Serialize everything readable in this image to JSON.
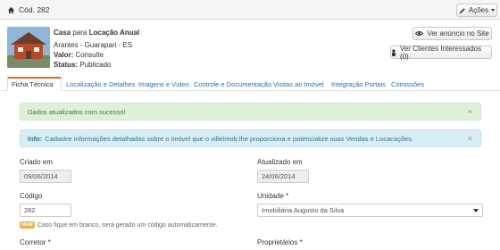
{
  "topbar": {
    "code_label": "Cód. 282",
    "actions_label": "Ações"
  },
  "property": {
    "title_type": "Casa",
    "title_connector": "para",
    "title_purpose": "Locação Anual",
    "location": "Arantes - Guarapari - ES",
    "value_label": "Valor:",
    "value": "Consulte",
    "status_label": "Status:",
    "status": "Publicado"
  },
  "buttons": {
    "view_site": "Ver anúncio no Site",
    "view_clients": "Ver Clientes Interessados (0)"
  },
  "tabs": [
    {
      "label": "Ficha Técnica"
    },
    {
      "label": "Localização e Detalhes"
    },
    {
      "label": "Imagens e Vídeo"
    },
    {
      "label": "Controle e Documentação"
    },
    {
      "label": "Visitas ao Imóvel"
    },
    {
      "label": "Integração Portais"
    },
    {
      "label": "Comissões"
    }
  ],
  "alerts": {
    "success": "Dados atualizados com sucesso!",
    "info_prefix": "Info:",
    "info_text": "Cadastre informações detalhadas sobre o imóvel que o villeImob lhe proporciona e potencialize suas Vendas e Locacações.",
    "close_glyph": "×"
  },
  "form": {
    "created_label": "Criado em",
    "created_value": "09/06/2014",
    "updated_label": "Atualizado em",
    "updated_value": "24/06/2014",
    "code_label": "Código",
    "code_value": "282",
    "unit_label": "Unidade *",
    "unit_value": "Imobiliária Augusto da Silva",
    "new_badge": "NEW",
    "code_help": "Caso fique em branco, será gerado um código automaticamente.",
    "broker_label": "Corretor *",
    "owners_label": "Proprietários *"
  },
  "colors": {
    "active_tab_accent": "#e2671b",
    "link": "#2a6fb0",
    "success_bg": "#dff0d8",
    "info_bg": "#d9edf7"
  }
}
